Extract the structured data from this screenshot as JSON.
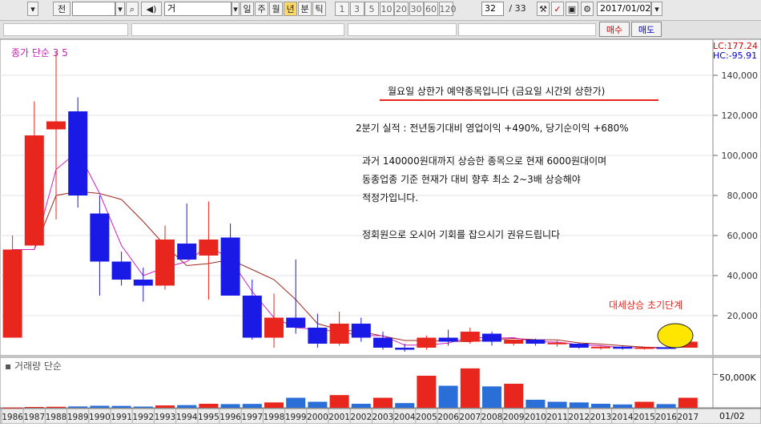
{
  "toolbar": {
    "stock_prefix": "전",
    "mode_value": "거",
    "period_buttons": [
      "일",
      "주",
      "월",
      "년",
      "분",
      "틱"
    ],
    "active_period": "년",
    "interval_buttons": [
      "1",
      "3",
      "5",
      "10",
      "20",
      "30",
      "60",
      "120"
    ],
    "page_value": "32",
    "page_total": "/ 33",
    "date_value": "2017/01/02"
  },
  "order": {
    "buy_label": "매수",
    "sell_label": "매도"
  },
  "price_panel": {
    "indicator_label": "종가 단순 3 5",
    "lc_label": "LC:177.24",
    "hc_label": "HC:-95.91"
  },
  "volume_panel": {
    "label": "거래량 단순",
    "axis_label": "50,000K",
    "date_readout": "01/02"
  },
  "annotations": {
    "headline": "월요일 상한가 예약종목입니다 (금요일 시간외 상한가)",
    "line1": "2분기 실적 : 전년동기대비 영업이익 +490%, 당기순이익 +680%",
    "line2": "과거 140000원대까지 상승한 종목으로 현재 6000원대이며",
    "line3": "동종업종 기준 현재가 대비 향후 최소 2~3배 상승해야",
    "line4": "적정가입니다.",
    "line5": "정회원으로 오시어 기회를 잡으시기 권유드립니다",
    "trend_label": "대세상승 초기단계"
  },
  "colors": {
    "up": "#e8261e",
    "down": "#1a1ae6",
    "ma3": "#d020c0",
    "ma5": "#a0281e",
    "highlight": "#ffe600",
    "trend_text": "#e8261e",
    "vol_up": "#e8261e",
    "vol_down": "#2a6ed8"
  },
  "chart_data": {
    "type": "candlestick",
    "title": "",
    "price_axis": {
      "min": 0,
      "max": 150000,
      "ticks": [
        20000,
        40000,
        60000,
        80000,
        100000,
        120000,
        140000
      ],
      "tick_labels": [
        "20,000",
        "40,000",
        "60,000",
        "80,000",
        "100,000",
        "120,000",
        "140,000"
      ]
    },
    "categories": [
      "1986",
      "1987",
      "1988",
      "1989",
      "1990",
      "1991",
      "1992",
      "1993",
      "1994",
      "1995",
      "1996",
      "1997",
      "1998",
      "1999",
      "2000",
      "2001",
      "2002",
      "2003",
      "2004",
      "2005",
      "2006",
      "2007",
      "2008",
      "2009",
      "2010",
      "2011",
      "2012",
      "2013",
      "2014",
      "2015",
      "2016",
      "2017"
    ],
    "candles": [
      {
        "o": 9000,
        "h": 60000,
        "l": 9000,
        "c": 53000
      },
      {
        "o": 55000,
        "h": 127000,
        "l": 55000,
        "c": 110000
      },
      {
        "o": 113000,
        "h": 152000,
        "l": 68000,
        "c": 117000
      },
      {
        "o": 122000,
        "h": 129000,
        "l": 74000,
        "c": 80000
      },
      {
        "o": 71000,
        "h": 80000,
        "l": 30000,
        "c": 47000
      },
      {
        "o": 47000,
        "h": 52000,
        "l": 35000,
        "c": 38000
      },
      {
        "o": 38000,
        "h": 44000,
        "l": 27000,
        "c": 35000
      },
      {
        "o": 35000,
        "h": 65000,
        "l": 33000,
        "c": 58000
      },
      {
        "o": 56000,
        "h": 76000,
        "l": 48000,
        "c": 48000
      },
      {
        "o": 50000,
        "h": 77000,
        "l": 28000,
        "c": 58000
      },
      {
        "o": 59000,
        "h": 66000,
        "l": 30000,
        "c": 30000
      },
      {
        "o": 30000,
        "h": 38000,
        "l": 8000,
        "c": 9000
      },
      {
        "o": 9000,
        "h": 31000,
        "l": 4000,
        "c": 19000
      },
      {
        "o": 19000,
        "h": 48000,
        "l": 11000,
        "c": 14000
      },
      {
        "o": 14000,
        "h": 21000,
        "l": 4000,
        "c": 6000
      },
      {
        "o": 6000,
        "h": 22000,
        "l": 5000,
        "c": 16000
      },
      {
        "o": 16000,
        "h": 19000,
        "l": 7000,
        "c": 9000
      },
      {
        "o": 9000,
        "h": 12000,
        "l": 3000,
        "c": 4000
      },
      {
        "o": 4000,
        "h": 6000,
        "l": 2000,
        "c": 3000
      },
      {
        "o": 4000,
        "h": 10000,
        "l": 3000,
        "c": 9000
      },
      {
        "o": 9000,
        "h": 13000,
        "l": 5000,
        "c": 7000
      },
      {
        "o": 7000,
        "h": 14000,
        "l": 6000,
        "c": 12000
      },
      {
        "o": 11000,
        "h": 12000,
        "l": 5000,
        "c": 7000
      },
      {
        "o": 6000,
        "h": 8000,
        "l": 5000,
        "c": 8000
      },
      {
        "o": 8000,
        "h": 8500,
        "l": 5000,
        "c": 6000
      },
      {
        "o": 6000,
        "h": 7500,
        "l": 4500,
        "c": 6500
      },
      {
        "o": 6000,
        "h": 6500,
        "l": 3500,
        "c": 4000
      },
      {
        "o": 4000,
        "h": 5000,
        "l": 3000,
        "c": 4500
      },
      {
        "o": 4500,
        "h": 5000,
        "l": 3000,
        "c": 3500
      },
      {
        "o": 3500,
        "h": 4500,
        "l": 3000,
        "c": 4200
      },
      {
        "o": 4200,
        "h": 4500,
        "l": 3500,
        "c": 3800
      },
      {
        "o": 4000,
        "h": 8500,
        "l": 4000,
        "c": 7000
      }
    ],
    "ma3": [
      53000,
      53000,
      93000,
      102000,
      81000,
      55000,
      40000,
      44000,
      47000,
      55000,
      48000,
      32000,
      19000,
      14000,
      13000,
      12000,
      10000,
      10000,
      5300,
      5300,
      6300,
      9300,
      8700,
      9000,
      7000,
      6800,
      5500,
      5000,
      4000,
      4000,
      3800,
      5000
    ],
    "ma5": [
      53000,
      53000,
      80000,
      82000,
      81000,
      78000,
      67000,
      55000,
      45000,
      46000,
      48000,
      43000,
      38000,
      28000,
      16000,
      13000,
      12000,
      9800,
      7600,
      7600,
      7200,
      7000,
      8000,
      8600,
      8000,
      7900,
      6400,
      5800,
      5000,
      4300,
      4000,
      4600
    ],
    "volume_axis": {
      "max": 60000,
      "ticks": [
        50000
      ],
      "tick_labels": [
        "50,000K"
      ]
    },
    "volume": [
      300,
      1200,
      1500,
      2000,
      3000,
      2800,
      1800,
      3500,
      4000,
      6000,
      5500,
      5800,
      8000,
      15000,
      9000,
      19000,
      6000,
      15000,
      7000,
      48000,
      33000,
      59000,
      32000,
      36000,
      12000,
      9000,
      8000,
      6000,
      5000,
      9000,
      5500,
      15000
    ],
    "volume_up": [
      true,
      true,
      true,
      false,
      false,
      false,
      false,
      true,
      false,
      true,
      false,
      false,
      true,
      false,
      false,
      true,
      false,
      true,
      false,
      true,
      false,
      true,
      false,
      true,
      false,
      false,
      false,
      false,
      false,
      true,
      false,
      true
    ]
  }
}
